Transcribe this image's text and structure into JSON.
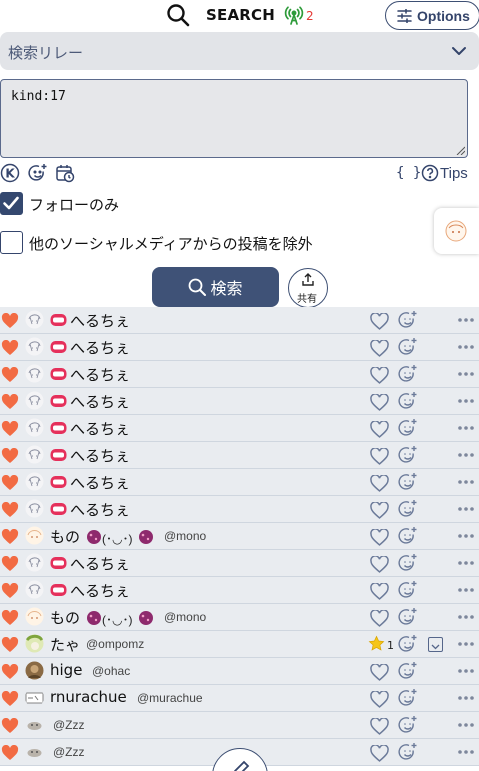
{
  "header": {
    "title": "SEARCH",
    "relay_count": "2",
    "options_label": "Options"
  },
  "relay_select": {
    "label": "検索リレー"
  },
  "query": {
    "value": "kind:17"
  },
  "toolbar": {
    "braces": "{ }",
    "tips_label": "Tips"
  },
  "options": {
    "follow_only_label": "フォローのみ",
    "follow_only_checked": true,
    "exclude_label": "他のソーシャルメディアからの投稿を除外",
    "exclude_checked": false
  },
  "actions": {
    "search_label": "検索",
    "share_label": "共有"
  },
  "results": [
    {
      "name": "へるちぇ",
      "handle": "",
      "avatar": "sketch",
      "deco": "mouth"
    },
    {
      "name": "へるちぇ",
      "handle": "",
      "avatar": "sketch",
      "deco": "mouth"
    },
    {
      "name": "へるちぇ",
      "handle": "",
      "avatar": "sketch",
      "deco": "mouth"
    },
    {
      "name": "へるちぇ",
      "handle": "",
      "avatar": "sketch",
      "deco": "mouth"
    },
    {
      "name": "へるちぇ",
      "handle": "",
      "avatar": "sketch",
      "deco": "mouth"
    },
    {
      "name": "へるちぇ",
      "handle": "",
      "avatar": "sketch",
      "deco": "mouth"
    },
    {
      "name": "へるちぇ",
      "handle": "",
      "avatar": "sketch",
      "deco": "mouth"
    },
    {
      "name": "へるちぇ",
      "handle": "",
      "avatar": "sketch",
      "deco": "mouth"
    },
    {
      "name": "もの",
      "name_suffix": "(･◡･)",
      "handle": "@mono",
      "avatar": "cream",
      "deco": "blob"
    },
    {
      "name": "へるちぇ",
      "handle": "",
      "avatar": "sketch",
      "deco": "mouth"
    },
    {
      "name": "へるちぇ",
      "handle": "",
      "avatar": "sketch",
      "deco": "mouth"
    },
    {
      "name": "もの",
      "name_suffix": "(･◡･)",
      "handle": "@mono",
      "avatar": "cream",
      "deco": "blob"
    },
    {
      "name": "たゃ",
      "handle": "@ompomz",
      "avatar": "green",
      "deco": "",
      "star_count": "1"
    },
    {
      "name": "hige",
      "handle": "@ohac",
      "avatar": "brown",
      "deco": ""
    },
    {
      "name": "rnurachue",
      "handle": "@murachue",
      "avatar": "line",
      "deco": ""
    },
    {
      "name": "",
      "handle": "@Zzz",
      "avatar": "small",
      "deco": ""
    },
    {
      "name": "",
      "handle": "@Zzz",
      "avatar": "small",
      "deco": ""
    }
  ],
  "colors": {
    "accent": "#3f5277",
    "heart": "#f26b43",
    "row_bg": "#e9ecf0",
    "relay_count": "#e53935"
  },
  "icons": {
    "header": [
      "search-icon",
      "relay-signal-icon",
      "sliders-icon"
    ],
    "toolbar": [
      "k-circle-icon",
      "emoji-add-icon",
      "calendar-clock-icon",
      "question-circle-icon"
    ],
    "row": [
      "heart-icon",
      "like-outline-icon",
      "reaction-add-icon",
      "more-dots-icon",
      "star-icon",
      "expand-icon"
    ],
    "fab": "compose-icon"
  }
}
